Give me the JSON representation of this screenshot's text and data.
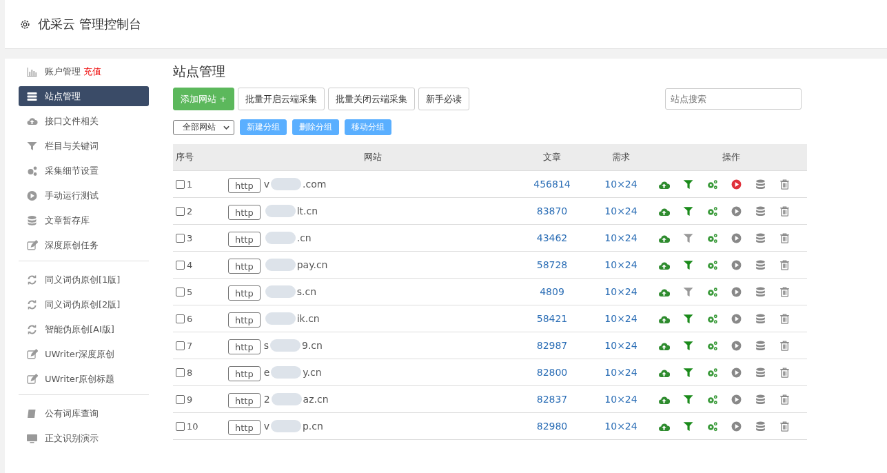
{
  "header": {
    "title": "优采云 管理控制台"
  },
  "sidebar": {
    "groups": [
      {
        "items": [
          {
            "label": "账户管理",
            "badge": "充值",
            "selected": false
          },
          {
            "label": "站点管理",
            "selected": true
          },
          {
            "label": "接口文件相关",
            "selected": false
          },
          {
            "label": "栏目与关键词",
            "selected": false
          },
          {
            "label": "采集细节设置",
            "selected": false
          },
          {
            "label": "手动运行测试",
            "selected": false
          },
          {
            "label": "文章暂存库",
            "selected": false
          },
          {
            "label": "深度原创任务",
            "selected": false
          }
        ]
      },
      {
        "items": [
          {
            "label": "同义词伪原创[1版]",
            "selected": false
          },
          {
            "label": "同义词伪原创[2版]",
            "selected": false
          },
          {
            "label": "智能伪原创[AI版]",
            "selected": false
          },
          {
            "label": "UWriter深度原创",
            "selected": false
          },
          {
            "label": "UWriter原创标题",
            "selected": false
          }
        ]
      },
      {
        "items": [
          {
            "label": "公有词库查询",
            "selected": false
          },
          {
            "label": "正文识别演示",
            "selected": false
          }
        ]
      }
    ]
  },
  "page_title": "站点管理",
  "toolbar": {
    "primary": "添加网站 +",
    "buttons": [
      "批量开启云端采集",
      "批量关闭云端采集",
      "新手必读"
    ],
    "search": {
      "placeholder": "站点搜索"
    }
  },
  "filter": {
    "select": "全部网站",
    "buttons": [
      "新建分组",
      "删除分组",
      "移动分组"
    ]
  },
  "table": {
    "columns": [
      "序号",
      "网站",
      "文章",
      "需求",
      "操作"
    ],
    "rows": [
      {
        "no": "1",
        "checked": false,
        "scheme": "http",
        "prefix": "v",
        "suffix": ".com",
        "articles": "456814",
        "demand": "10×24",
        "filter_on": true,
        "running": true
      },
      {
        "no": "2",
        "checked": false,
        "scheme": "http",
        "prefix": "",
        "suffix": "lt.cn",
        "articles": "83870",
        "demand": "10×24",
        "filter_on": true,
        "running": false
      },
      {
        "no": "3",
        "checked": false,
        "scheme": "http",
        "prefix": "",
        "suffix": ".cn",
        "articles": "43462",
        "demand": "10×24",
        "filter_on": false,
        "running": false
      },
      {
        "no": "4",
        "checked": false,
        "scheme": "http",
        "prefix": "",
        "suffix": "pay.cn",
        "articles": "58728",
        "demand": "10×24",
        "filter_on": true,
        "running": false
      },
      {
        "no": "5",
        "checked": false,
        "scheme": "http",
        "prefix": "",
        "suffix": "s.cn",
        "articles": "4809",
        "demand": "10×24",
        "filter_on": false,
        "running": false
      },
      {
        "no": "6",
        "checked": false,
        "scheme": "http",
        "prefix": "",
        "suffix": "ik.cn",
        "articles": "58421",
        "demand": "10×24",
        "filter_on": true,
        "running": false
      },
      {
        "no": "7",
        "checked": false,
        "scheme": "http",
        "prefix": "s",
        "suffix": "9.cn",
        "articles": "82987",
        "demand": "10×24",
        "filter_on": true,
        "running": false
      },
      {
        "no": "8",
        "checked": false,
        "scheme": "http",
        "prefix": "e",
        "suffix": "y.cn",
        "articles": "82800",
        "demand": "10×24",
        "filter_on": true,
        "running": false
      },
      {
        "no": "9",
        "checked": false,
        "scheme": "http",
        "prefix": "2",
        "suffix": "az.cn",
        "articles": "82837",
        "demand": "10×24",
        "filter_on": true,
        "running": false
      },
      {
        "no": "10",
        "checked": false,
        "scheme": "http",
        "prefix": "v",
        "suffix": "p.cn",
        "articles": "82980",
        "demand": "10×24",
        "filter_on": true,
        "running": false
      }
    ]
  }
}
